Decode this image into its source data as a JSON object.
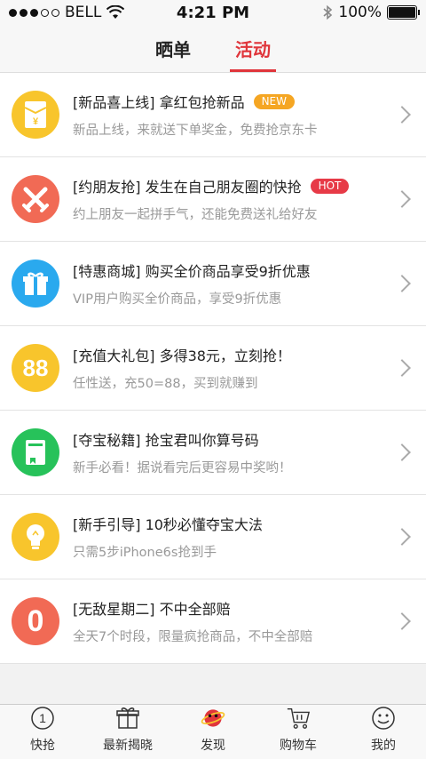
{
  "status_bar": {
    "carrier": "BELL",
    "time": "4:21 PM",
    "battery": "100%",
    "battery_level": 1.0
  },
  "top_tabs": [
    {
      "label": "晒单",
      "active": false
    },
    {
      "label": "活动",
      "active": true
    }
  ],
  "list": [
    {
      "title": "[新品喜上线] 拿红包抢新品",
      "badge": "NEW",
      "badge_color": "#f5a623",
      "subtitle": "新品上线，来就送下单奖金，免费抢京东卡",
      "icon": "red-envelope-icon",
      "icon_bg": "#f8c52c"
    },
    {
      "title": "[约朋友抢] 发生在自己朋友圈的快抢",
      "badge": "HOT",
      "badge_color": "#e73a47",
      "subtitle": "约上朋友一起拼手气，还能免费送礼给好友",
      "icon": "crossed-swords-icon",
      "icon_bg": "#f16a55"
    },
    {
      "title": "[特惠商城] 购买全价商品享受9折优惠",
      "badge": "",
      "badge_color": "",
      "subtitle": "VIP用户购买全价商品，享受9折优惠",
      "icon": "gift-box-icon",
      "icon_bg": "#2aa9ee"
    },
    {
      "title": "[充值大礼包] 多得38元，立刻抢！",
      "badge": "",
      "badge_color": "",
      "subtitle": "任性送，充50=88，买到就赚到",
      "icon": "number-88-icon",
      "icon_bg": "#f8c52c",
      "icon_text": "88"
    },
    {
      "title": "[夺宝秘籍] 抢宝君叫你算号码",
      "badge": "",
      "badge_color": "",
      "subtitle": "新手必看！据说看完后更容易中奖哟！",
      "icon": "book-icon",
      "icon_bg": "#27c25a"
    },
    {
      "title": "[新手引导] 10秒必懂夺宝大法",
      "badge": "",
      "badge_color": "",
      "subtitle": "只需5步iPhone6s抢到手",
      "icon": "lightbulb-icon",
      "icon_bg": "#f8c52c"
    },
    {
      "title": "[无敌星期二] 不中全部赔",
      "badge": "",
      "badge_color": "",
      "subtitle": "全天7个时段，限量疯抢商品，不中全部赔",
      "icon": "number-0-icon",
      "icon_bg": "#f16a55",
      "icon_text": "0"
    }
  ],
  "bottom_nav": [
    {
      "label": "快抢",
      "icon": "number-1-circle-icon",
      "icon_text": "1"
    },
    {
      "label": "最新揭晓",
      "icon": "gift-icon"
    },
    {
      "label": "发现",
      "icon": "planet-icon"
    },
    {
      "label": "购物车",
      "icon": "cart-icon"
    },
    {
      "label": "我的",
      "icon": "smiley-icon"
    }
  ]
}
